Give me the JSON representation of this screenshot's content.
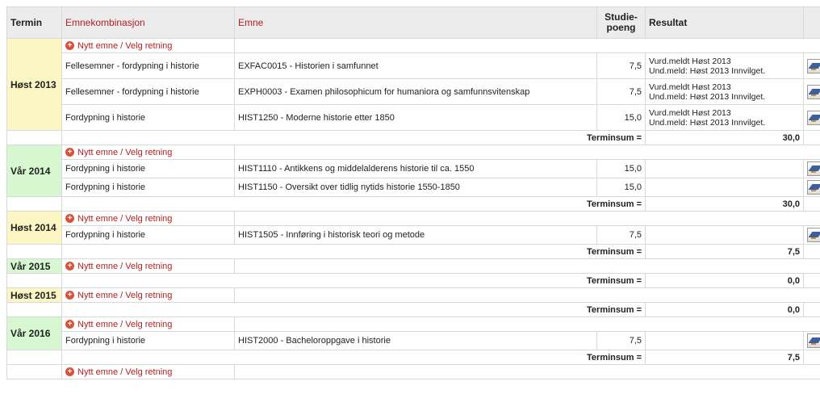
{
  "headers": {
    "termin": "Termin",
    "emnekombinasjon": "Emnekombinasjon",
    "emne": "Emne",
    "studiepoeng_line1": "Studie-",
    "studiepoeng_line2": "poeng",
    "resultat": "Resultat"
  },
  "add_link_label": "Nytt emne / Velg retning",
  "terminsum_label": "Terminsum =",
  "terms": [
    {
      "name": "Høst 2013",
      "season": "hoest",
      "courses": [
        {
          "combo": "Fellesemner - fordypning i historie",
          "emne": "EXFAC0015 - Historien i samfunnet",
          "sp": "7,5",
          "res1": "Vurd.meldt Høst 2013",
          "res2": "Und.meld: Høst 2013 Innvilget."
        },
        {
          "combo": "Fellesemner - fordypning i historie",
          "emne": "EXPH0003 - Examen philosophicum for humaniora og samfunnsvitenskap",
          "sp": "7,5",
          "res1": "Vurd.meldt Høst 2013",
          "res2": "Und.meld: Høst 2013 Innvilget."
        },
        {
          "combo": "Fordypning i historie",
          "emne": "HIST1250 - Moderne historie etter 1850",
          "sp": "15,0",
          "res1": "Vurd.meldt Høst 2013",
          "res2": "Und.meld: Høst 2013 Innvilget."
        }
      ],
      "sum": "30,0"
    },
    {
      "name": "Vår 2014",
      "season": "vaar",
      "courses": [
        {
          "combo": "Fordypning i historie",
          "emne": "HIST1110 - Antikkens og middelalderens historie til ca. 1550",
          "sp": "15,0"
        },
        {
          "combo": "Fordypning i historie",
          "emne": "HIST1150 - Oversikt over tidlig nytids historie 1550-1850",
          "sp": "15,0"
        }
      ],
      "sum": "30,0"
    },
    {
      "name": "Høst 2014",
      "season": "hoest",
      "courses": [
        {
          "combo": "Fordypning i historie",
          "emne": "HIST1505 - Innføring i historisk teori og metode",
          "sp": "7,5"
        }
      ],
      "sum": "7,5"
    },
    {
      "name": "Vår 2015",
      "season": "vaar",
      "courses": [],
      "sum": "0,0"
    },
    {
      "name": "Høst 2015",
      "season": "hoest",
      "courses": [],
      "sum": "0,0"
    },
    {
      "name": "Vår 2016",
      "season": "vaar",
      "courses": [
        {
          "combo": "Fordypning i historie",
          "emne": "HIST2000 - Bacheloroppgave i historie",
          "sp": "7,5"
        }
      ],
      "sum": "7,5"
    }
  ],
  "colors": {
    "hoest_bg": "#fbf6c3",
    "vaar_bg": "#d6f7d0",
    "link_red": "#b22222",
    "header_bg": "#ececec"
  },
  "icons": {
    "add": "plus-circle-icon",
    "edit": "edit-pen-icon"
  }
}
